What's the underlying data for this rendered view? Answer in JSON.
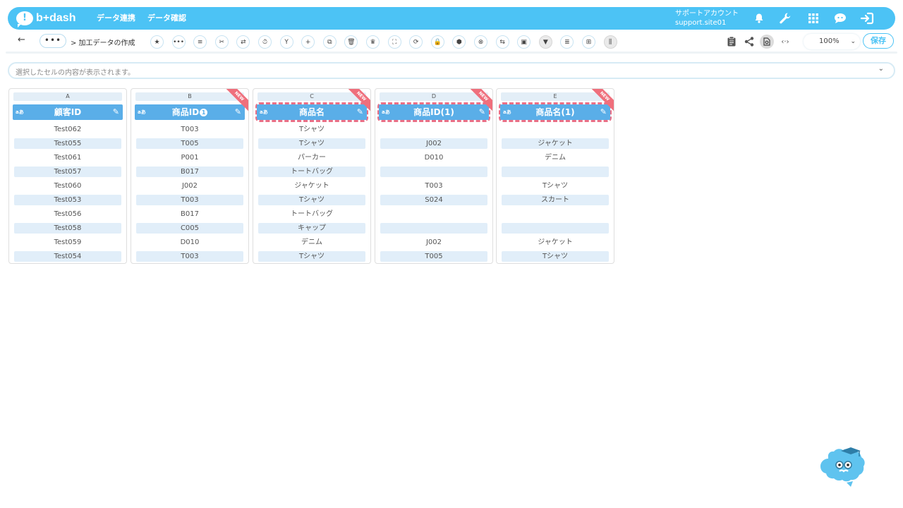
{
  "app": {
    "logo_mark": "!",
    "logo_text": "b+dash"
  },
  "nav": {
    "data_link": "データ連携",
    "data_check": "データ確認"
  },
  "account": {
    "name": "サポートアカウント",
    "id": "support.site01"
  },
  "header_icons": [
    "bell-icon",
    "wrench-icon",
    "grid-icon",
    "chat-icon",
    "logout-icon"
  ],
  "toolbar": {
    "more_label": "•••",
    "breadcrumb": "> 加工データの作成",
    "zoom": "100%",
    "save_label": "保存",
    "tool_glyphs": [
      "★",
      "•••",
      "≡",
      "✂",
      "⇄",
      "⏱",
      "Y",
      "+",
      "⧉",
      "🗑",
      "♛",
      "⛶",
      "⟳",
      "🔒",
      "⬢",
      "⊗",
      "⇆",
      "▣",
      "▼",
      "≣",
      "⊞",
      "⫼"
    ]
  },
  "cellbar": {
    "placeholder": "選択したセルの内容が表示されます。"
  },
  "columns": [
    {
      "letter": "A",
      "title": "顧客ID",
      "badge": "",
      "is_new": false,
      "highlighted": false,
      "cells": [
        "Test062",
        "Test055",
        "Test061",
        "Test057",
        "Test060",
        "Test053",
        "Test056",
        "Test058",
        "Test059",
        "Test054"
      ]
    },
    {
      "letter": "B",
      "title": "商品ID",
      "badge": "1",
      "is_new": true,
      "highlighted": false,
      "cells": [
        "T003",
        "T005",
        "P001",
        "B017",
        "J002",
        "T003",
        "B017",
        "C005",
        "D010",
        "T003"
      ]
    },
    {
      "letter": "C",
      "title": "商品名",
      "badge": "",
      "is_new": true,
      "highlighted": true,
      "cells": [
        "Tシャツ",
        "Tシャツ",
        "パーカー",
        "トートバッグ",
        "ジャケット",
        "Tシャツ",
        "トートバッグ",
        "キャップ",
        "デニム",
        "Tシャツ"
      ]
    },
    {
      "letter": "D",
      "title": "商品ID(1)",
      "badge": "",
      "is_new": true,
      "highlighted": true,
      "cells": [
        "",
        "J002",
        "D010",
        "",
        "T003",
        "S024",
        "",
        "",
        "J002",
        "T005"
      ]
    },
    {
      "letter": "E",
      "title": "商品名(1)",
      "badge": "",
      "is_new": true,
      "highlighted": true,
      "cells": [
        "",
        "ジャケット",
        "デニム",
        "",
        "Tシャツ",
        "スカート",
        "",
        "",
        "ジャケット",
        "Tシャツ"
      ]
    }
  ],
  "type_label": "aあ",
  "new_label": "NEW",
  "colors": {
    "accent": "#4cc3f5",
    "header_blue": "#5aaee8",
    "highlight": "#ea6f86",
    "row_alt": "#e1eef9"
  }
}
